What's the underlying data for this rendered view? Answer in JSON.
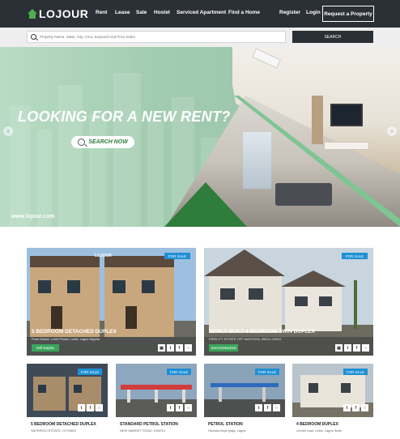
{
  "brand": {
    "name": "LOJOUR",
    "accent": "#4caf50"
  },
  "nav": {
    "links": [
      "Rent",
      "Lease",
      "Sale",
      "Hostel",
      "Serviced Apartment",
      "Find a Home"
    ],
    "register": "Register",
    "login": "Login",
    "request_button": "Request a Property"
  },
  "search": {
    "placeholder": "Property Name, State, City, Area, Keyword And Price Index",
    "button": "SEARCH"
  },
  "hero": {
    "headline": "LOOKING FOR A NEW RENT?",
    "cta": "SEARCH NOW",
    "url": "www.lojour.com",
    "prev": "‹",
    "next": "›"
  },
  "featured": [
    {
      "badge": "FOR SALE",
      "watermark": "LOJOUR",
      "title": "5 BEDROOM DETACHED DUPLEX",
      "subtitle": "Pearl Estate, Lekki Phase, Lekki, Lagos Nigeria",
      "status": "Sell Duplex"
    },
    {
      "badge": "FOR SALE",
      "title": "NEWLY BUILT 4 BEDROOM TWIN DUPLEX",
      "subtitle": "FIDELITY ESTATE OFF AWOYAYA, IBEJU-LEKKI",
      "status": "Semi-Detached"
    }
  ],
  "listings": [
    {
      "badge": "FOR SALE",
      "title": "5 BEDROOM DETACHED DUPLEX",
      "subtitle": "SAFERIGO ESTATE, OYO/IBO"
    },
    {
      "badge": "FOR SALE",
      "title": "STANDARD PETROL STATION",
      "subtitle": "NEW MARKET ROAD, ENUGU"
    },
    {
      "badge": "FOR SALE",
      "title": "PETROL STATION",
      "subtitle": "Otobala Ikeja Ipaja, Lagos"
    },
    {
      "badge": "FOR SALE",
      "title": "4 BEDROOM DUPLEX",
      "subtitle": "Orchid road, Lekki, Lagos State"
    }
  ],
  "share_icons": [
    "camera-icon",
    "twitter-icon",
    "facebook-icon",
    "whatsapp-icon"
  ],
  "colors": {
    "navbar": "#2b3036",
    "hero_green": "#a9cfb6",
    "dark_green": "#2e7d3b",
    "badge_blue": "#1e90d6",
    "status_green": "#3aa55a"
  }
}
